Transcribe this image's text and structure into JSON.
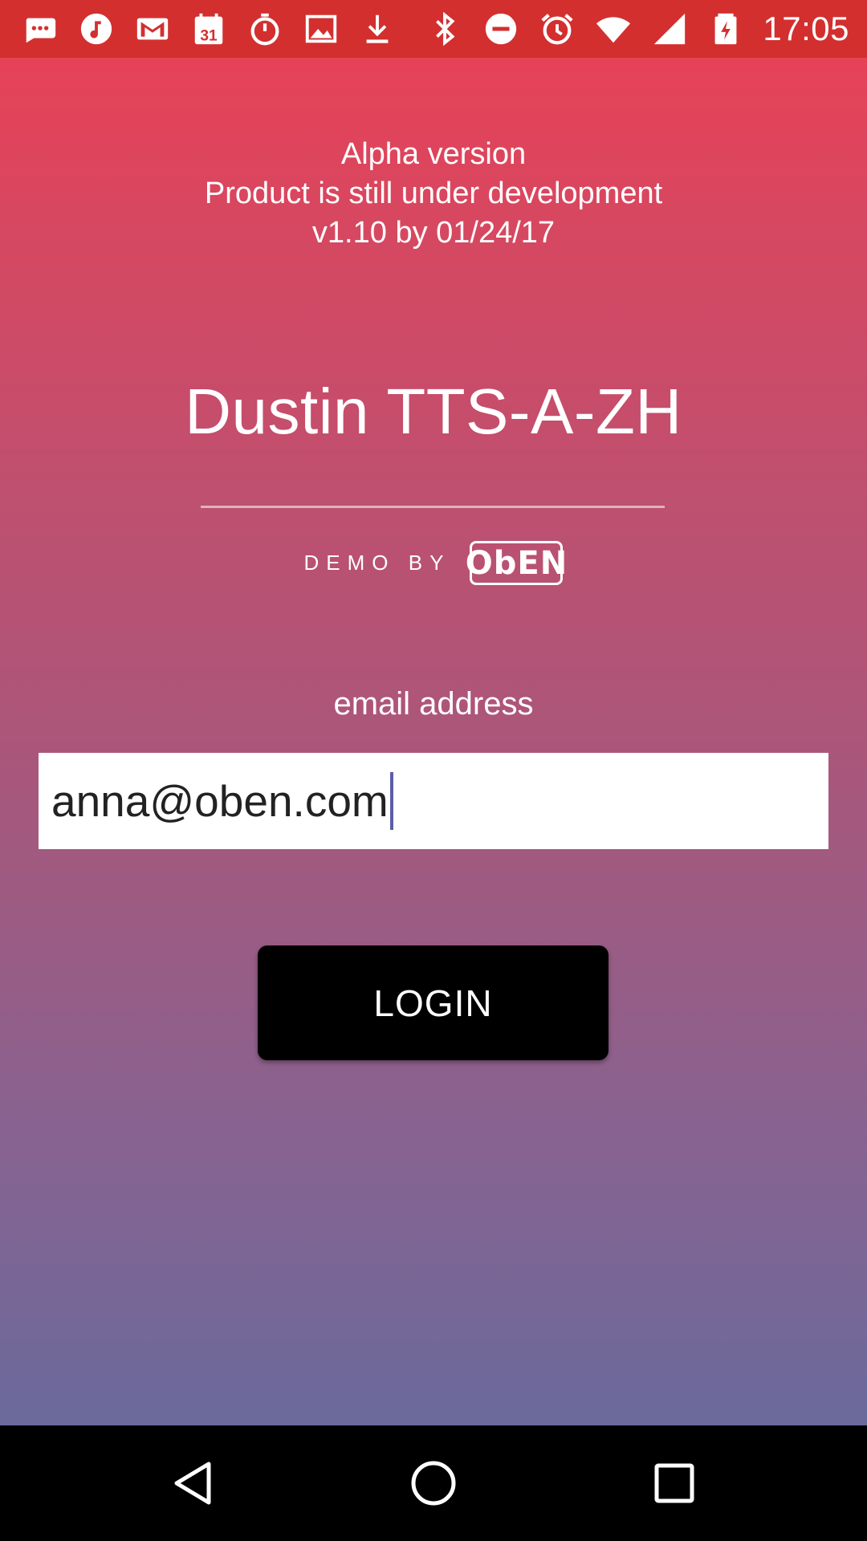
{
  "status_bar": {
    "time": "17:05",
    "notification_icons": [
      "message-icon",
      "music-icon",
      "gmail-icon",
      "calendar-icon",
      "timer-icon",
      "image-icon",
      "download-icon"
    ],
    "calendar_day": "31",
    "system_icons": [
      "bluetooth-icon",
      "do-not-disturb-icon",
      "alarm-icon",
      "wifi-icon",
      "cell-signal-icon",
      "battery-charging-icon"
    ]
  },
  "notice": {
    "line1": "Alpha version",
    "line2": "Product is still under development",
    "line3": "v1.10 by 01/24/17"
  },
  "app_title": "Dustin TTS-A-ZH",
  "demo_by": {
    "label": "DEMO BY",
    "logo_text": "ObEN"
  },
  "email": {
    "label": "email address",
    "value": "anna@oben.com"
  },
  "login_button": "LOGIN",
  "colors": {
    "status_bar": "#d32f2f",
    "gradient_top": "#e64257",
    "gradient_bottom": "#6a6a9b",
    "button": "#000000",
    "caret": "#5c5ea8"
  }
}
